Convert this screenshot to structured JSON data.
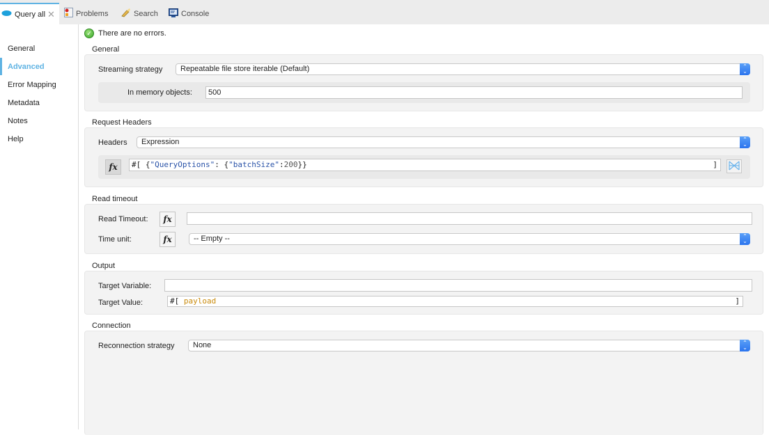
{
  "tabs": [
    {
      "label": "Query all",
      "icon": "salesforce-cloud-icon",
      "active": true,
      "closable": true
    },
    {
      "label": "Problems",
      "icon": "problems-icon"
    },
    {
      "label": "Search",
      "icon": "search-flashlight-icon"
    },
    {
      "label": "Console",
      "icon": "console-icon"
    }
  ],
  "sidebar": {
    "items": [
      {
        "label": "General"
      },
      {
        "label": "Advanced",
        "active": true
      },
      {
        "label": "Error Mapping"
      },
      {
        "label": "Metadata"
      },
      {
        "label": "Notes"
      },
      {
        "label": "Help"
      }
    ]
  },
  "status": {
    "message": "There are no errors."
  },
  "sections": {
    "general": {
      "title": "General",
      "streaming_label": "Streaming strategy",
      "streaming_value": "Repeatable file store iterable (Default)",
      "memory_label": "In memory objects:",
      "memory_value": "500"
    },
    "request_headers": {
      "title": "Request Headers",
      "headers_label": "Headers",
      "headers_value": "Expression",
      "expr_prefix": "#[",
      "expr_open": " {",
      "expr_key1": "\"QueryOptions\"",
      "expr_colon": ": {",
      "expr_key2": "\"batchSize\"",
      "expr_colon2": ":",
      "expr_num": "200",
      "expr_close": "}}",
      "expr_end": "]"
    },
    "read_timeout": {
      "title": "Read timeout",
      "timeout_label": "Read Timeout:",
      "timeout_value": "",
      "unit_label": "Time unit:",
      "unit_value": "-- Empty --"
    },
    "output": {
      "title": "Output",
      "target_var_label": "Target Variable:",
      "target_var_value": "",
      "target_value_label": "Target Value:",
      "target_value_prefix": "#[",
      "target_value_expr": "payload",
      "target_value_end": "]"
    },
    "connection": {
      "title": "Connection",
      "reconnection_label": "Reconnection strategy",
      "reconnection_value": "None"
    }
  },
  "fx_label": "fx"
}
